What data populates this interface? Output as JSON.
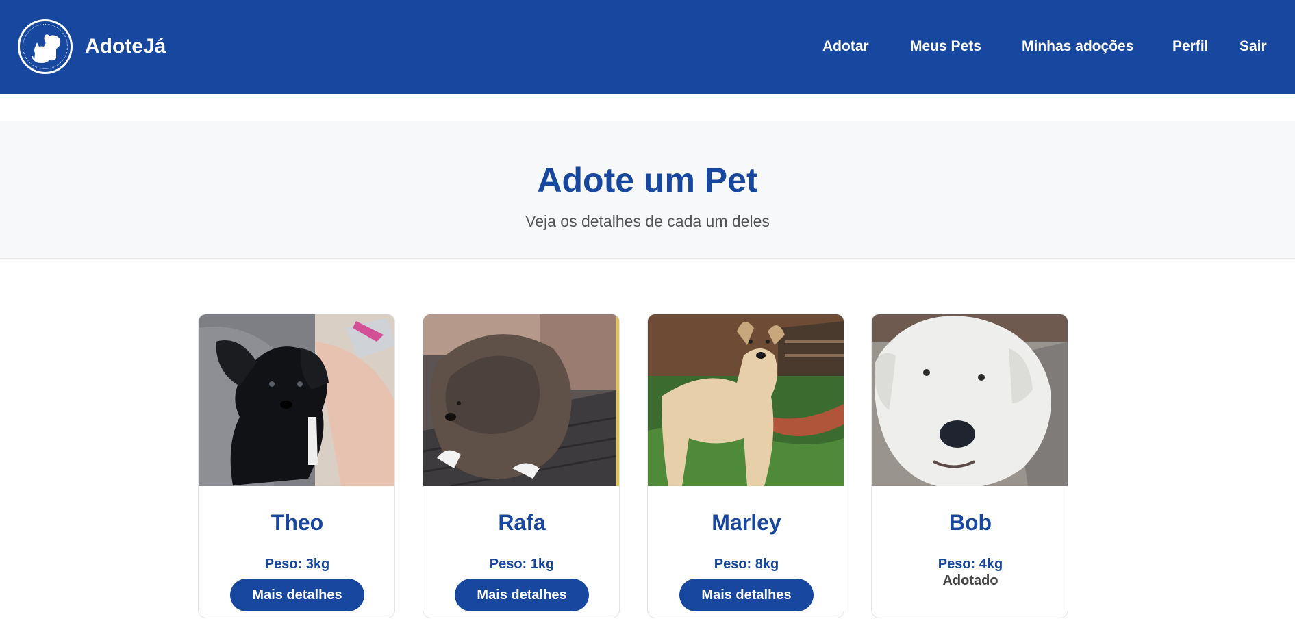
{
  "header": {
    "brand_name": "AdoteJá",
    "logo_icon": "cat-and-dog-logo-icon",
    "nav": [
      {
        "label": "Adotar"
      },
      {
        "label": "Meus Pets"
      },
      {
        "label": "Minhas adoções"
      },
      {
        "label": "Perfil"
      },
      {
        "label": "Sair"
      }
    ],
    "background_color": "#17479e"
  },
  "hero": {
    "title": "Adote um Pet",
    "subtitle": "Veja os detalhes de cada um deles"
  },
  "pets": [
    {
      "name": "Theo",
      "weight": "Peso: 3kg",
      "action": "Mais detalhes",
      "status": null,
      "photo": "black puppy"
    },
    {
      "name": "Rafa",
      "weight": "Peso: 1kg",
      "action": "Mais detalhes",
      "status": null,
      "photo": "brown fluffy puppy"
    },
    {
      "name": "Marley",
      "weight": "Peso: 8kg",
      "action": "Mais detalhes",
      "status": null,
      "photo": "cream dog on grass"
    },
    {
      "name": "Bob",
      "weight": "Peso: 4kg",
      "action": null,
      "status": "Adotado",
      "photo": "white shaggy dog"
    }
  ],
  "colors": {
    "primary": "#17479e",
    "hero_background": "#f7f8fa",
    "status_text": "#444444"
  }
}
